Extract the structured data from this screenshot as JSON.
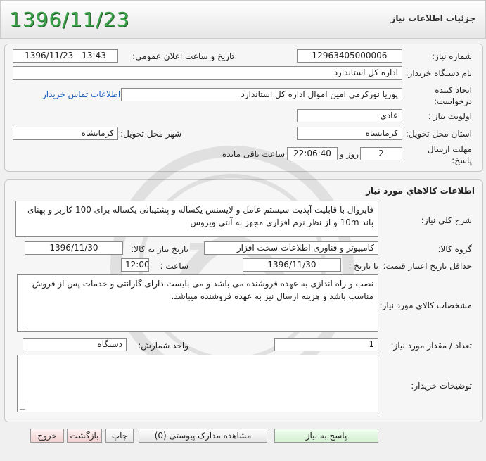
{
  "header": {
    "title": "جزئیات اطلاعات نیاز",
    "date_display": "1396/11/23"
  },
  "general": {
    "need_number_label": "شماره نیاز:",
    "need_number": "12963405000006",
    "announce_label": "تاریخ و ساعت اعلان عمومی:",
    "announce_value": "1396/11/23 - 13:43",
    "buyer_org_label": "نام دستگاه خریدار:",
    "buyer_org": "اداره کل استاندارد",
    "creator_label": "ایجاد کننده درخواست:",
    "creator": "پوریا نورکرمی امین اموال اداره کل استاندارد",
    "contact_link": "اطلاعات تماس خریدار",
    "priority_label": "اولویت نیاز :",
    "priority": "عادي",
    "province_label": "استان محل تحویل:",
    "province": "کرمانشاه",
    "city_label": "شهر محل تحویل:",
    "city": "کرمانشاه",
    "deadline_label": "مهلت ارسال پاسخ:",
    "deadline_days": "2",
    "days_word": "روز و",
    "deadline_time": "22:06:40",
    "remaining_word": "ساعت باقی مانده"
  },
  "goods": {
    "section_title": "اطلاعات کالاهاي مورد نياز",
    "description_label": "شرح کلي نياز:",
    "description": "فایروال با قابلیت آپدیت سیستم عامل و لایسنس یکساله و پشتیبانی یکساله برای 100 کاربر و پهنای باند 10m و از نظر نرم افزاری مجهز به آنتی ویروس",
    "group_label": "گروه کالا:",
    "group": "کامپیوتر و فناوری اطلاعات-سخت افزار",
    "need_date_label": "تاریخ نیاز به کالا:",
    "need_date": "1396/11/30",
    "price_validity_label": "حداقل تاریخ اعتبار قیمت:",
    "until_date_label": "تا تاریخ :",
    "until_date": "1396/11/30",
    "hour_label": "ساعت :",
    "hour": "12:00",
    "specs_label": "مشخصات کالاي مورد نياز:",
    "specs": "نصب و راه اندازی به عهده فروشنده می باشد و می بایست دارای گارانتی و خدمات پس از فروش مناسب باشد و هزینه ارسال نیز به عهده فروشنده میباشد.",
    "qty_label": "تعداد / مقدار مورد نیاز:",
    "qty": "1",
    "unit_label": "واحد شمارش:",
    "unit": "دستگاه",
    "buyer_notes_label": "توضیحات خریدار:",
    "buyer_notes": ""
  },
  "buttons": {
    "reply": "پاسخ به نیاز",
    "attachments": "مشاهده مدارک پیوستی (0)",
    "print": "چاپ",
    "back": "بازگشت",
    "exit": "خروج"
  },
  "colors": {
    "date_green": "#3aa34a",
    "link_blue": "#1b5fc1"
  }
}
